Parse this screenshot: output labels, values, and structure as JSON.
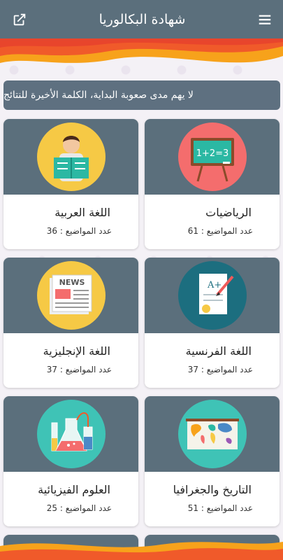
{
  "appbar": {
    "title": "شهادة البكالوريا",
    "menu_icon": "hamburger-menu-icon",
    "share_icon": "open-external-icon"
  },
  "banner": {
    "text": "لا يهم مدى صعوبة البداية، الكلمة الأخيرة للنتائج"
  },
  "subjects": [
    {
      "name": "الرياضيات",
      "count": "عدد المواضيع : 61",
      "icon": "math-blackboard-icon",
      "bg": "#f46d6d"
    },
    {
      "name": "اللغة العربية",
      "count": "عدد المواضيع : 36",
      "icon": "reading-student-icon",
      "bg": "#f6c945"
    },
    {
      "name": "اللغة الفرنسية",
      "count": "عدد المواضيع : 37",
      "icon": "graded-paper-icon",
      "bg": "#1c6e7f"
    },
    {
      "name": "اللغة الإنجليزية",
      "count": "عدد المواضيع : 37",
      "icon": "newspaper-icon",
      "bg": "#f6c945"
    },
    {
      "name": "التاريخ والجغرافيا",
      "count": "عدد المواضيع : 51",
      "icon": "world-map-icon",
      "bg": "#3fc3b6"
    },
    {
      "name": "العلوم الفيزيائية",
      "count": "عدد المواضيع : 25",
      "icon": "lab-flask-icon",
      "bg": "#3fc3b6"
    }
  ],
  "colors": {
    "appbar": "#5b6f7c",
    "card_header": "#5b6f7c",
    "wave_orange": "#f7a21b",
    "wave_red": "#e8452c"
  }
}
